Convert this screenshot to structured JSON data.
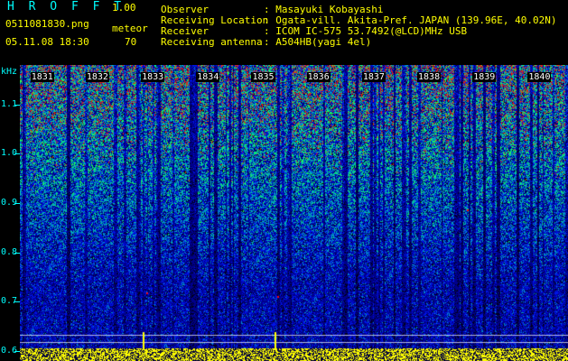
{
  "header": {
    "app_name": "H R O F F T",
    "version": "1.00",
    "filename": "0511081830.png",
    "datetime": "05.11.08 18:30",
    "mode_label": "meteor",
    "mode_value": "70",
    "info_labels": [
      "Observer",
      "Receiving Location",
      "Receiver",
      "Receiving antenna"
    ],
    "info_values": [
      ": Masayuki Kobayashi",
      ": Ogata-vill. Akita-Pref. JAPAN (139.96E, 40.02N)",
      ": ICOM IC-575 53.7492(@LCD)MHz USB",
      ": A504HB(yagi 4el)"
    ]
  },
  "spectrogram": {
    "y_unit": "kHz",
    "y_ticks": [
      "1.1",
      "1.0",
      "0.9",
      "0.8",
      "0.7",
      "0.6"
    ],
    "y_tick_values": [
      1.1,
      1.0,
      0.9,
      0.8,
      0.7,
      0.6
    ],
    "y_range": [
      0.58,
      1.18
    ],
    "time_ticks": [
      "1831",
      "1832",
      "1833",
      "1834",
      "1835",
      "1836",
      "1837",
      "1838",
      "1839",
      "1840"
    ],
    "time_tick_minutes": [
      1831,
      1832,
      1833,
      1834,
      1835,
      1836,
      1837,
      1838,
      1839,
      1840
    ],
    "time_range": [
      1830.58,
      1840.5
    ],
    "colors": {
      "background": "#000000",
      "low": "#000080",
      "mid": "#0000ff",
      "high": "#00c8c8",
      "peak": "#00ff50",
      "echo": "#ff0000",
      "activity_bar": "#ffff00"
    }
  }
}
